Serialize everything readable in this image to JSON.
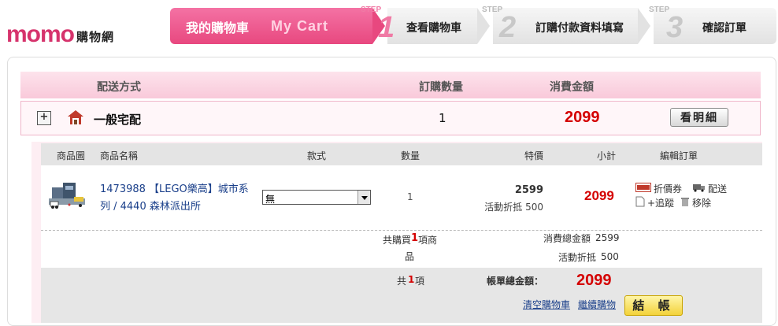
{
  "header": {
    "logo_brand": "momo",
    "logo_sub": "購物網",
    "steps": [
      {
        "zh": "我的購物車",
        "en": "My Cart"
      },
      {
        "label": "STEP",
        "num": "1",
        "text": "查看購物車"
      },
      {
        "label": "STEP",
        "num": "2",
        "text": "訂購付款資料填寫"
      },
      {
        "label": "STEP",
        "num": "3",
        "text": "確認訂單"
      }
    ]
  },
  "shipping_header": {
    "method": "配送方式",
    "quantity": "訂購數量",
    "amount": "消費金額"
  },
  "shipping_row": {
    "expand": "+",
    "method": "一般宅配",
    "quantity": "1",
    "amount": "2099",
    "detail_button": "看明細"
  },
  "detail_header": {
    "image": "商品圖",
    "name": "商品名稱",
    "style": "款式",
    "quantity": "數量",
    "price": "特價",
    "subtotal": "小計",
    "edit": "編輯訂單"
  },
  "product": {
    "name": "1473988 【LEGO樂高】城市系列 / 4440 森林派出所",
    "style_selected": "無",
    "quantity": "1",
    "price": "2599",
    "discount": "活動折抵 500",
    "subtotal": "2099",
    "actions": {
      "coupon": "折價券",
      "ship": "配送",
      "track": "+追蹤",
      "remove": "移除"
    }
  },
  "summary": {
    "bought_prefix": "共購買",
    "bought_count": "1",
    "bought_suffix_1": "項商",
    "bought_suffix_2": "品",
    "consume_label": "消費總金額",
    "consume_value": "2599",
    "discount_label": "活動折抵",
    "discount_value": "500",
    "items_prefix": "共",
    "items_count": "1",
    "items_suffix": "項",
    "total_label": "帳單總金額：",
    "total_value": "2099",
    "clear_cart": "清空購物車",
    "continue_shopping": "繼續購物",
    "checkout": "結 帳"
  },
  "colors": {
    "brand_pink": "#e8487f",
    "price_red": "#d40000",
    "link_blue": "#1a3f8a"
  }
}
